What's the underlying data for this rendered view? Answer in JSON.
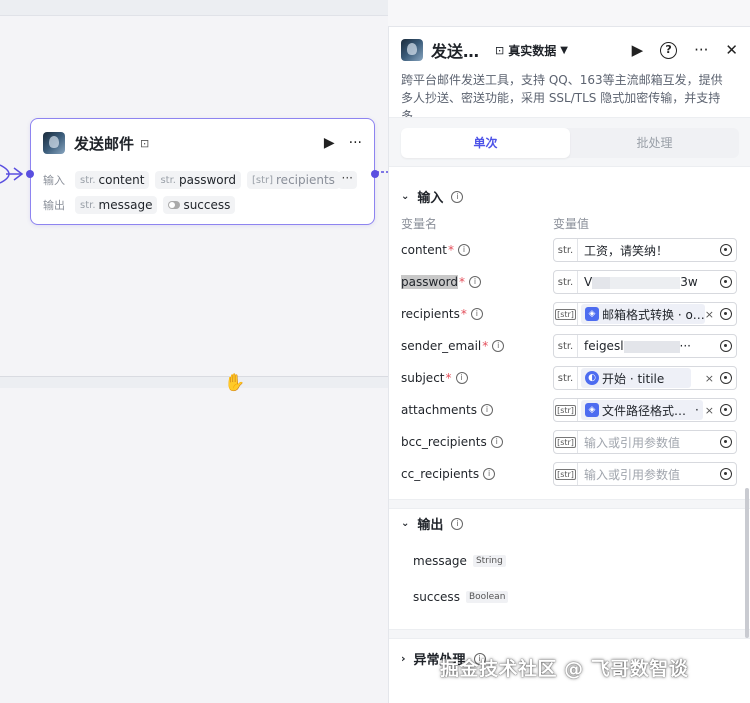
{
  "node": {
    "title": "发送邮件",
    "input_label": "输入",
    "output_label": "输出",
    "inputs": [
      {
        "type": "str.",
        "name": "content"
      },
      {
        "type": "str.",
        "name": "password"
      },
      {
        "type": "[str]",
        "name": "recipients"
      }
    ],
    "more": "···",
    "outputs": [
      {
        "type": "str.",
        "name": "message"
      },
      {
        "type": "toggle-icon",
        "name": "success"
      }
    ]
  },
  "panel": {
    "title": "发送…",
    "data_mode": "真实数据",
    "description": "跨平台邮件发送工具，支持 QQ、163等主流邮箱互发，提供多人抄送、密送功能，采用 SSL/TLS 隐式加密传输，并支持多…",
    "tabs": [
      {
        "label": "单次",
        "active": true
      },
      {
        "label": "批处理",
        "active": false
      }
    ],
    "input_section": {
      "title": "输入",
      "col_name": "变量名",
      "col_value": "变量值",
      "rows": [
        {
          "name": "content",
          "required": true,
          "type": "str.",
          "value": "工资，请笑纳！"
        },
        {
          "name": "password",
          "required": true,
          "type": "str.",
          "value_prefix": "V",
          "value_suffix": "3w"
        },
        {
          "name": "recipients",
          "required": true,
          "type": "[str]",
          "ref": "邮箱格式转换 · o…"
        },
        {
          "name": "sender_email",
          "required": true,
          "type": "str.",
          "value_prefix": "feigesl",
          "value_suffix": "···"
        },
        {
          "name": "subject",
          "required": true,
          "type": "str.",
          "ref": "开始 · titile"
        },
        {
          "name": "attachments",
          "required": false,
          "type": "[str]",
          "ref": "文件路径格式…",
          "extra": "·"
        },
        {
          "name": "bcc_recipients",
          "required": false,
          "type": "[str]",
          "placeholder": "输入或引用参数值"
        },
        {
          "name": "cc_recipients",
          "required": false,
          "type": "[str]",
          "placeholder": "输入或引用参数值"
        }
      ]
    },
    "output_section": {
      "title": "输出",
      "rows": [
        {
          "name": "message",
          "type": "String"
        },
        {
          "name": "success",
          "type": "Boolean"
        }
      ]
    },
    "error_section": {
      "title": "异常处理"
    }
  },
  "watermark": "掘金技术社区 @ 飞哥数智谈",
  "colors": {
    "accent": "#4d53e8",
    "node_border": "#8e84f0",
    "required": "#e34d59"
  }
}
